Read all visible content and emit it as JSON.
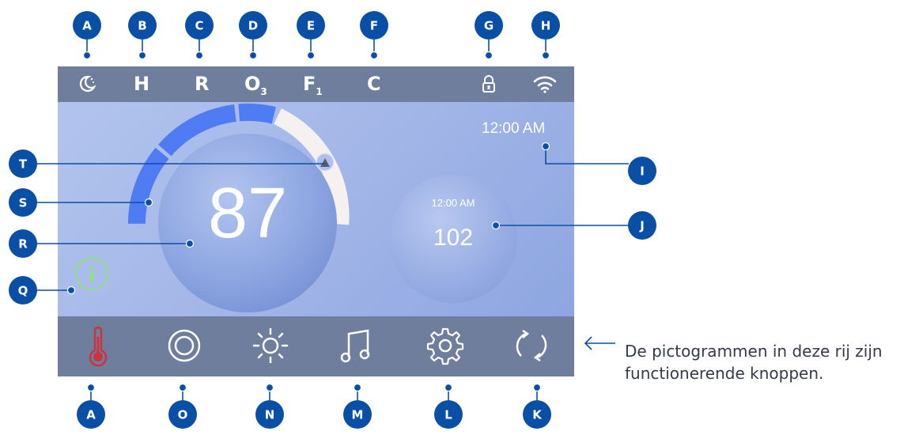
{
  "status_bar": {
    "h": "H",
    "r": "R",
    "ozone": "O",
    "ozone_sub": "3",
    "filter": "F",
    "filter_sub": "1",
    "c": "C"
  },
  "display": {
    "clock_top": "12:00 AM",
    "current_temp": "87",
    "set_time": "12:00 AM",
    "set_temp": "102"
  },
  "icons": {
    "status": [
      "moon-icon",
      "lock-icon",
      "wifi-icon"
    ],
    "info": "info-icon",
    "buttons": [
      "thermometer-icon",
      "rings-icon",
      "sun-icon",
      "music-note-icon",
      "gear-icon",
      "refresh-icon"
    ]
  },
  "callouts": {
    "top": [
      "A",
      "B",
      "C",
      "D",
      "E",
      "F",
      "G",
      "H"
    ],
    "right": [
      "I",
      "J"
    ],
    "bottom": [
      "A",
      "O",
      "N",
      "M",
      "L",
      "K"
    ],
    "left": [
      "T",
      "S",
      "R",
      "Q"
    ]
  },
  "note": "De pictogrammen in deze rij zijn functionerende knoppen.",
  "colors": {
    "badge": "#0a4fa6",
    "status_bar": "#6f7e9c",
    "gauge_fill": "#4f7cf2",
    "info_ring": "#8fe07e",
    "thermo": "#c9353f"
  }
}
